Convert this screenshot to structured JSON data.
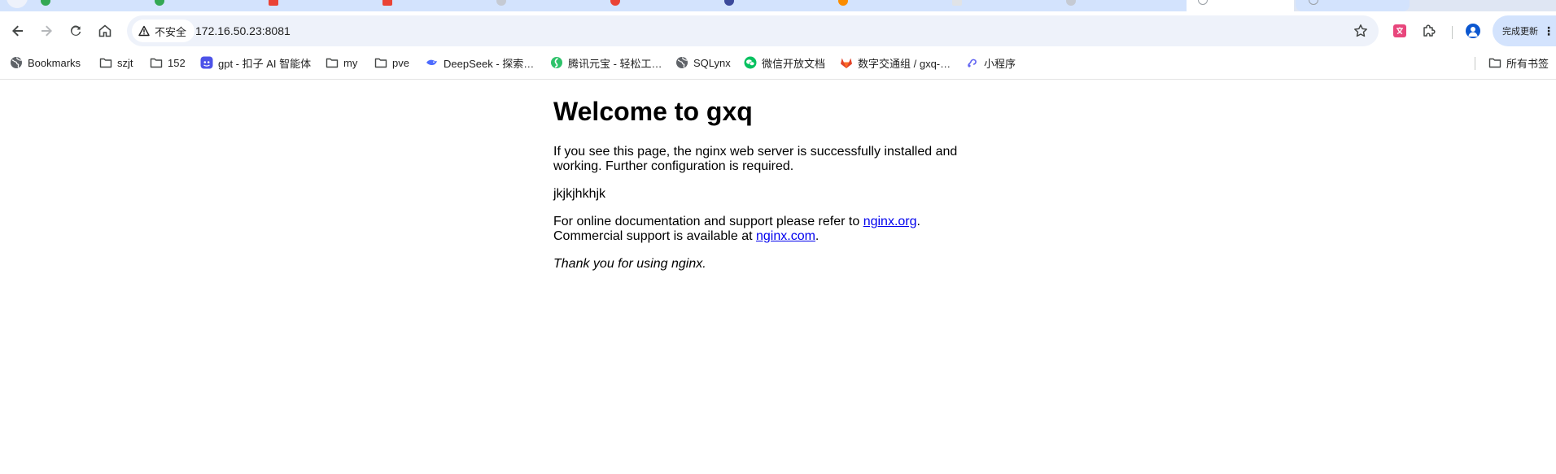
{
  "browser": {
    "address_bar": {
      "security_label": "不安全",
      "url": "172.16.50.23:8081"
    },
    "update_button_label": "完成更新",
    "colors": {
      "tabstrip": "#d3e3fd",
      "omnibox": "#eef2fa",
      "accent": "#0b57d0"
    }
  },
  "bookmarks": {
    "items": [
      {
        "label": "Bookmarks",
        "icon": "globe-icon"
      },
      {
        "label": "szjt",
        "icon": "folder-icon"
      },
      {
        "label": "152",
        "icon": "folder-icon"
      },
      {
        "label": "gpt - 扣子 AI 智能体",
        "icon": "coze-icon"
      },
      {
        "label": "my",
        "icon": "folder-icon"
      },
      {
        "label": "pve",
        "icon": "folder-icon"
      },
      {
        "label": "DeepSeek - 探索…",
        "icon": "deepseek-icon"
      },
      {
        "label": "腾讯元宝 - 轻松工…",
        "icon": "yuanbao-icon"
      },
      {
        "label": "SQLynx",
        "icon": "globe-icon"
      },
      {
        "label": "微信开放文档",
        "icon": "wechat-icon"
      },
      {
        "label": "数字交通组 / gxq-…",
        "icon": "gitlab-icon"
      },
      {
        "label": "小程序",
        "icon": "miniprogram-icon"
      }
    ],
    "all_bookmarks_label": "所有书签"
  },
  "page": {
    "heading": "Welcome to gxq",
    "intro": "If you see this page, the nginx web server is successfully installed and working. Further configuration is required.",
    "custom_text": "jkjkjhkhjk",
    "docs_prefix": "For online documentation and support please refer to ",
    "docs_link": "nginx.org",
    "docs_suffix": ".",
    "commercial_prefix": "Commercial support is available at ",
    "commercial_link": "nginx.com",
    "commercial_suffix": ".",
    "thanks": "Thank you for using nginx."
  }
}
